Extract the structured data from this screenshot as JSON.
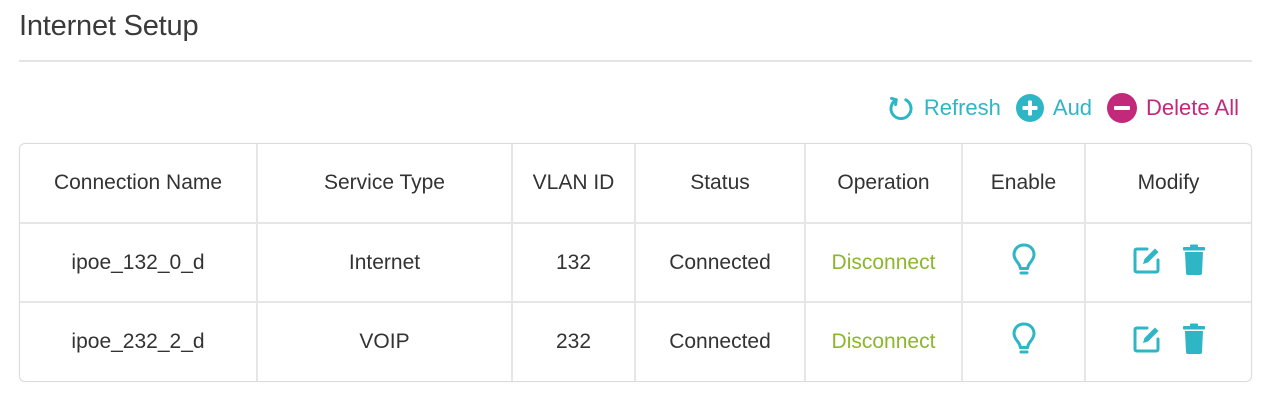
{
  "page": {
    "title": "Internet Setup"
  },
  "toolbar": {
    "refresh_label": "Refresh",
    "add_label": "Aud",
    "delete_all_label": "Delete All"
  },
  "table": {
    "columns": [
      "Connection Name",
      "Service Type",
      "VLAN ID",
      "Status",
      "Operation",
      "Enable",
      "Modify"
    ],
    "rows": [
      {
        "connection_name": "ipoe_132_0_d",
        "service_type": "Internet",
        "vlan_id": "132",
        "status": "Connected",
        "operation": "Disconnect",
        "enable_icon": "bulb-icon",
        "modify_icons": [
          "edit-icon",
          "trash-icon"
        ]
      },
      {
        "connection_name": "ipoe_232_2_d",
        "service_type": "VOIP",
        "vlan_id": "232",
        "status": "Connected",
        "operation": "Disconnect",
        "enable_icon": "bulb-icon",
        "modify_icons": [
          "edit-icon",
          "trash-icon"
        ]
      }
    ]
  },
  "colors": {
    "accent": "#2fb6c6",
    "danger": "#c2297a",
    "operation_link": "#8bb72a"
  }
}
